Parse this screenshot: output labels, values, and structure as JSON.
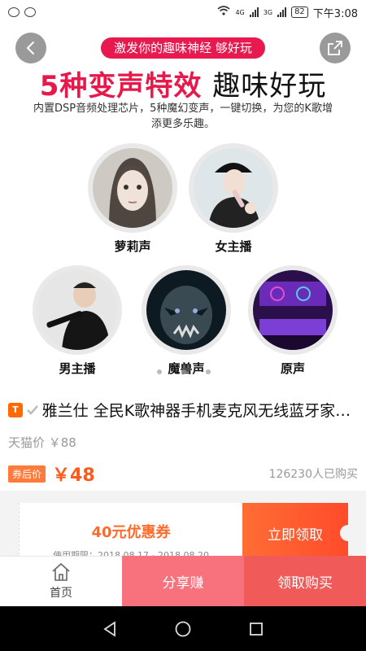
{
  "status_bar": {
    "net_label_1": "4G",
    "net_label_2": "3G",
    "battery": "82",
    "time": "下午3:08"
  },
  "banner": {
    "slogan": "激发你的趣味神经 够好玩",
    "headline_red": "5种变声特效",
    "headline_dark": "趣味好玩",
    "subtext": "内置DSP音频处理芯片，5种魔幻变声，一键切换，为您的K歌增添更多乐趣。",
    "effects": [
      {
        "label": "萝莉声"
      },
      {
        "label": "女主播"
      },
      {
        "label": "男主播"
      },
      {
        "label": "魔兽声"
      },
      {
        "label": "原声"
      }
    ],
    "pager_total": 3,
    "pager_active_index": 1
  },
  "product": {
    "badge": "T",
    "title": "雅兰仕 全民K歌神器手机麦克风无线蓝牙家用...",
    "original_price": "天猫价 ￥88",
    "coupon_tag": "券后价",
    "current_price": "￥48",
    "sold": "126230人已购买"
  },
  "coupon": {
    "amount": "40元优惠券",
    "period": "使用期限：2018.08.17 - 2018.08.20",
    "claim": "立即领取"
  },
  "bottom_bar": {
    "home": "首页",
    "share": "分享赚",
    "buy": "领取购买"
  },
  "colors": {
    "accent_red": "#e6194a",
    "price_orange": "#ff5a1a",
    "share_pink": "#f8727e",
    "buy_red": "#f05b5a"
  }
}
